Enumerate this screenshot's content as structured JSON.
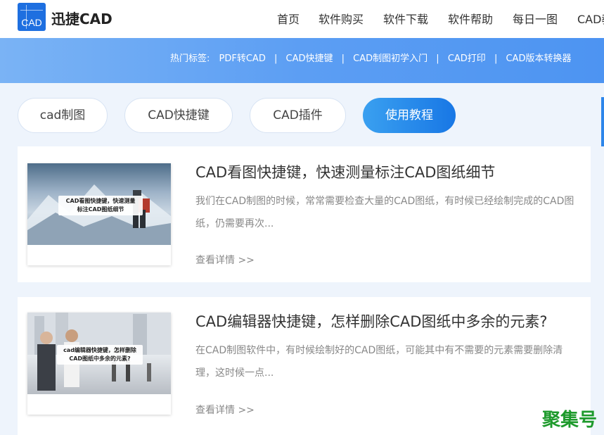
{
  "header": {
    "logo_mark": "CAD",
    "brand": "迅捷CAD",
    "nav": [
      {
        "label": "首页"
      },
      {
        "label": "软件购买"
      },
      {
        "label": "软件下载"
      },
      {
        "label": "软件帮助"
      },
      {
        "label": "每日一图"
      },
      {
        "label": "CAD教"
      }
    ]
  },
  "hot_tags": {
    "label": "热门标签:",
    "tags": [
      "PDF转CAD",
      "CAD快捷键",
      "CAD制图初学入门",
      "CAD打印",
      "CAD版本转换器"
    ],
    "separator": "|"
  },
  "categories": [
    {
      "label": "cad制图",
      "active": false
    },
    {
      "label": "CAD快捷键",
      "active": false
    },
    {
      "label": "CAD插件",
      "active": false
    },
    {
      "label": "使用教程",
      "active": true
    }
  ],
  "articles": [
    {
      "title": "CAD看图快捷键，快速测量标注CAD图纸细节",
      "desc": "我们在CAD制图的时候，常常需要检查大量的CAD图纸，有时候已经绘制完成的CAD图纸，仍需要再次...",
      "more": "查看详情 >>",
      "thumb_caption_line1": "CAD看图快捷键，快速测量",
      "thumb_caption_line2": "标注CAD图纸细节"
    },
    {
      "title": "CAD编辑器快捷键，怎样删除CAD图纸中多余的元素?",
      "desc": "在CAD制图软件中，有时候绘制好的CAD图纸，可能其中有不需要的元素需要删除清理，这时候一点...",
      "more": "查看详情 >>",
      "thumb_caption_line1": "cad编辑器快捷键，怎样删除",
      "thumb_caption_line2": "CAD图纸中多余的元素?"
    }
  ],
  "watermark": "聚集号",
  "colors": {
    "accent": "#1e6fe0",
    "banner": "#5c9ef3",
    "active_pill": "#2a8cec",
    "watermark": "#1e9a2c"
  }
}
